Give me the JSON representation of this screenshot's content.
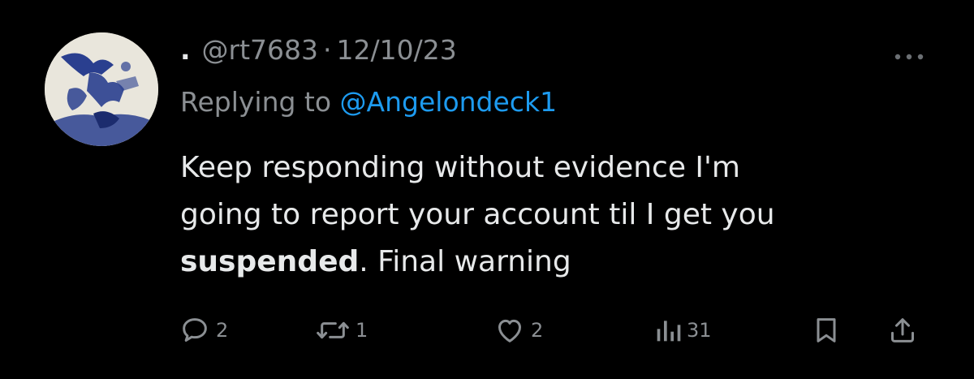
{
  "tweet": {
    "display_name": ".",
    "handle": "@rt7683",
    "separator": "·",
    "date": "12/10/23",
    "more_icon": "more-horizontal-icon",
    "reply_prefix": "Replying to",
    "reply_handle": "@Angelondeck1",
    "text_line1": "Keep responding without evidence I'm",
    "text_line2": "going to report your account til I get you",
    "text_bold": "suspended",
    "text_rest": ". Final warning"
  },
  "actions": {
    "reply_count": "2",
    "retweet_count": "1",
    "like_count": "2",
    "views_count": "31"
  },
  "colors": {
    "background": "#000000",
    "text": "#e7e9ea",
    "muted": "#8b8f93",
    "link": "#1d9bf0",
    "avatar_ink": "#2a3f8f"
  }
}
